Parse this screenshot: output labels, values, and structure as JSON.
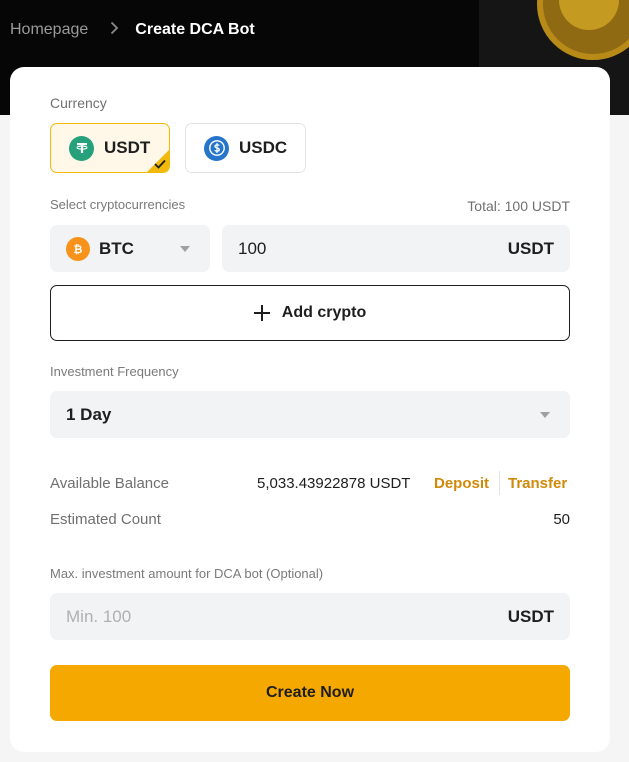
{
  "breadcrumb": {
    "home": "Homepage",
    "separator": ">",
    "current": "Create DCA Bot"
  },
  "form": {
    "currency_label": "Currency",
    "currencies": [
      {
        "symbol": "USDT",
        "icon": "tether-icon",
        "color": "#26a17b",
        "selected": true
      },
      {
        "symbol": "USDC",
        "icon": "usdc-icon",
        "color": "#2775ca",
        "selected": false
      }
    ],
    "select_crypto_label": "Select cryptocurrencies",
    "total": "Total: 100 USDT",
    "coin": {
      "symbol": "BTC",
      "icon": "bitcoin-icon",
      "color": "#f7931a"
    },
    "amount": {
      "value": "100",
      "unit": "USDT"
    },
    "add_crypto_label": "Add crypto",
    "frequency_label": "Investment Frequency",
    "frequency_value": "1 Day",
    "available_balance_label": "Available Balance",
    "available_balance_value": "5,033.43922878 USDT",
    "deposit_label": "Deposit",
    "transfer_label": "Transfer",
    "estimated_count_label": "Estimated Count",
    "estimated_count_value": "50",
    "max_investment_label": "Max. investment amount for DCA bot (Optional)",
    "max_investment_placeholder": "Min. 100",
    "max_investment_unit": "USDT",
    "create_button_label": "Create Now"
  },
  "colors": {
    "accent": "#f5a800",
    "link": "#d08a0a",
    "selected_border": "#f0b90b"
  }
}
